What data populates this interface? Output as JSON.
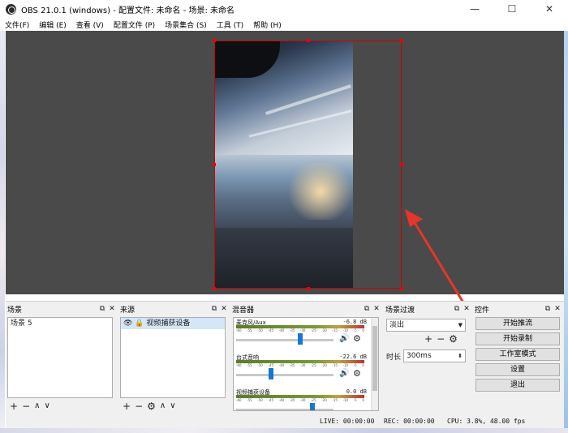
{
  "window": {
    "title": "OBS 21.0.1 (windows) - 配置文件: 未命名 - 场景: 未命名",
    "controls": [
      "—",
      "☐",
      "✕"
    ]
  },
  "menu": [
    "文件(F)",
    "编辑 (E)",
    "查看 (V)",
    "配置文件 (P)",
    "场景集合 (S)",
    "工具 (T)",
    "帮助 (H)"
  ],
  "panels": {
    "scenes": {
      "title": "场景",
      "items": [
        "场景 5"
      ],
      "toolbar": [
        "+",
        "−",
        "∧",
        "∨"
      ]
    },
    "sources": {
      "title": "来源",
      "items": [
        "视频捕获设备"
      ],
      "toolbar": [
        "+",
        "−",
        "⚙",
        "∧",
        "∨"
      ]
    },
    "mixer": {
      "title": "混音器",
      "channels": [
        {
          "name": "麦克风/Aux",
          "db": "-6.8 dB",
          "level": 0.67
        },
        {
          "name": "台式音响",
          "db": "-22.6 dB",
          "level": 0.35
        },
        {
          "name": "视频捕获设备",
          "db": "0.0 dB",
          "level": 0.8
        }
      ],
      "tick_labels": [
        "-60",
        "-55",
        "-50",
        "-45",
        "-40",
        "-35",
        "-30",
        "-25",
        "-20",
        "-15",
        "-10",
        "-5",
        "0"
      ]
    },
    "transitions": {
      "title": "场景过渡",
      "selected": "淡出",
      "duration_label": "时长",
      "duration_value": "300ms"
    },
    "controls": {
      "title": "控件",
      "buttons": [
        "开始推流",
        "开始录制",
        "工作室模式",
        "设置",
        "退出"
      ]
    },
    "header_buttons": [
      "⧉",
      "✕"
    ]
  },
  "status": {
    "live": "LIVE: 00:00:00",
    "rec": "REC: 00:00:00",
    "cpu": "CPU: 3.8%, 48.00 fps"
  }
}
